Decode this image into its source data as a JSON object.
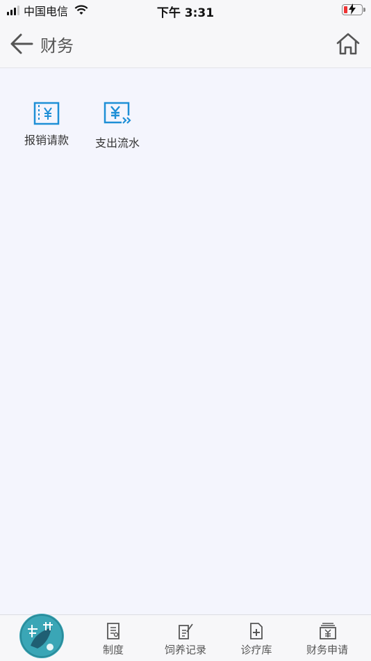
{
  "status_bar": {
    "carrier": "中国电信",
    "time": "下午 3:31"
  },
  "nav": {
    "title": "财务"
  },
  "tiles": [
    {
      "label": "报销请款",
      "icon": "reimbursement-icon"
    },
    {
      "label": "支出流水",
      "icon": "expense-flow-icon"
    }
  ],
  "tabbar": {
    "logo_icon": "app-logo-icon",
    "items": [
      {
        "label": "制度",
        "icon": "document-icon"
      },
      {
        "label": "饲养记录",
        "icon": "edit-note-icon"
      },
      {
        "label": "诊疗库",
        "icon": "medical-file-icon"
      },
      {
        "label": "财务申请",
        "icon": "finance-yen-icon"
      }
    ]
  },
  "colors": {
    "accent": "#1e8fd6",
    "background": "#f4f5fd",
    "logo": "#3aa6b6"
  }
}
